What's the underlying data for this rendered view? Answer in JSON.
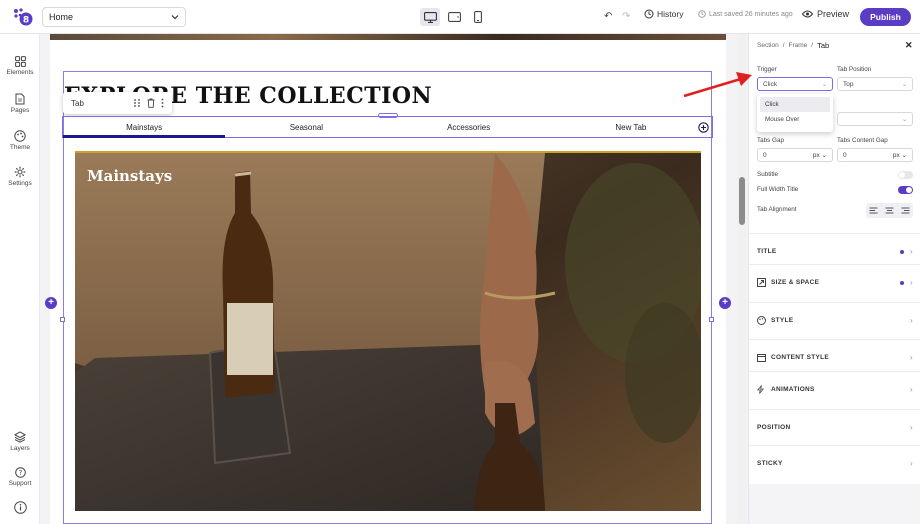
{
  "topbar": {
    "logo": "builder-logo",
    "page_select": {
      "value": "Home"
    },
    "devices": [
      "desktop-icon",
      "tablet-icon",
      "mobile-icon"
    ],
    "active_device": "desktop",
    "history_label": "History",
    "saved_text": "Last saved 26 minutes ago",
    "preview_label": "Preview",
    "publish_label": "Publish"
  },
  "sidebar": {
    "top_items": [
      {
        "label": "Elements",
        "icon": "grid-icon"
      },
      {
        "label": "Pages",
        "icon": "pages-icon"
      },
      {
        "label": "Theme",
        "icon": "palette-icon"
      },
      {
        "label": "Settings",
        "icon": "gear-icon"
      }
    ],
    "bottom_items": [
      {
        "label": "Layers",
        "icon": "layers-icon"
      },
      {
        "label": "Support",
        "icon": "help-icon"
      },
      {
        "label": "",
        "icon": "info-icon"
      }
    ]
  },
  "canvas": {
    "heading": "EXPLORE THE COLLECTION",
    "toolbar_label": "Tab",
    "tabs": [
      "Mainstays",
      "Seasonal",
      "Accessories",
      "New Tab"
    ],
    "active_tab": 0,
    "image_title": "Mainstays"
  },
  "panel": {
    "breadcrumb": [
      "Section",
      "Frame",
      "Tab"
    ],
    "trigger": {
      "label": "Trigger",
      "value": "Click",
      "options": [
        "Click",
        "Mouse Over"
      ]
    },
    "tab_position": {
      "label": "Tab Position",
      "value": "Top"
    },
    "tabs_gap": {
      "label": "Tabs Gap",
      "value": "0",
      "unit": "px"
    },
    "tabs_content_gap": {
      "label": "Tabs Content Gap",
      "value": "0",
      "unit": "px"
    },
    "subtitle": {
      "label": "Subtitle",
      "on": false
    },
    "full_width_title": {
      "label": "Full Width Title",
      "on": true
    },
    "tab_alignment": {
      "label": "Tab Alignment"
    },
    "sections": [
      {
        "label": "TITLE",
        "icon": "",
        "dot": true
      },
      {
        "label": "SIZE & SPACE",
        "icon": "resize-icon",
        "dot": true
      },
      {
        "label": "STYLE",
        "icon": "palette-icon",
        "dot": false
      },
      {
        "label": "CONTENT STYLE",
        "icon": "window-icon",
        "dot": false
      },
      {
        "label": "ANIMATIONS",
        "icon": "bolt-icon",
        "dot": false
      },
      {
        "label": "POSITION",
        "icon": "",
        "dot": false
      },
      {
        "label": "STICKY",
        "icon": "",
        "dot": false
      }
    ]
  },
  "colors": {
    "accent": "#5b3cc4",
    "selection": "#7c6ee0",
    "annotation_arrow": "#e02020"
  }
}
